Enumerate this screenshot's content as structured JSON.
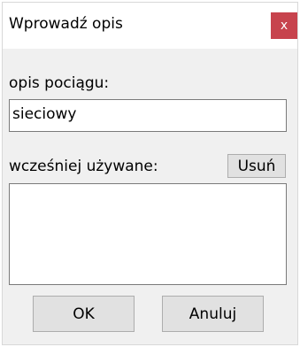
{
  "dialog": {
    "title": "Wprowadź opis",
    "close_label": "x"
  },
  "description": {
    "label": "opis pociągu:",
    "value": "sieciowy"
  },
  "history": {
    "label": "wcześniej używane:",
    "delete_label": "Usuń",
    "items": []
  },
  "buttons": {
    "ok_label": "OK",
    "cancel_label": "Anuluj"
  },
  "colors": {
    "close_button": "#c7434d",
    "client_background": "#f0f0f0",
    "button_face": "#e1e1e1"
  }
}
